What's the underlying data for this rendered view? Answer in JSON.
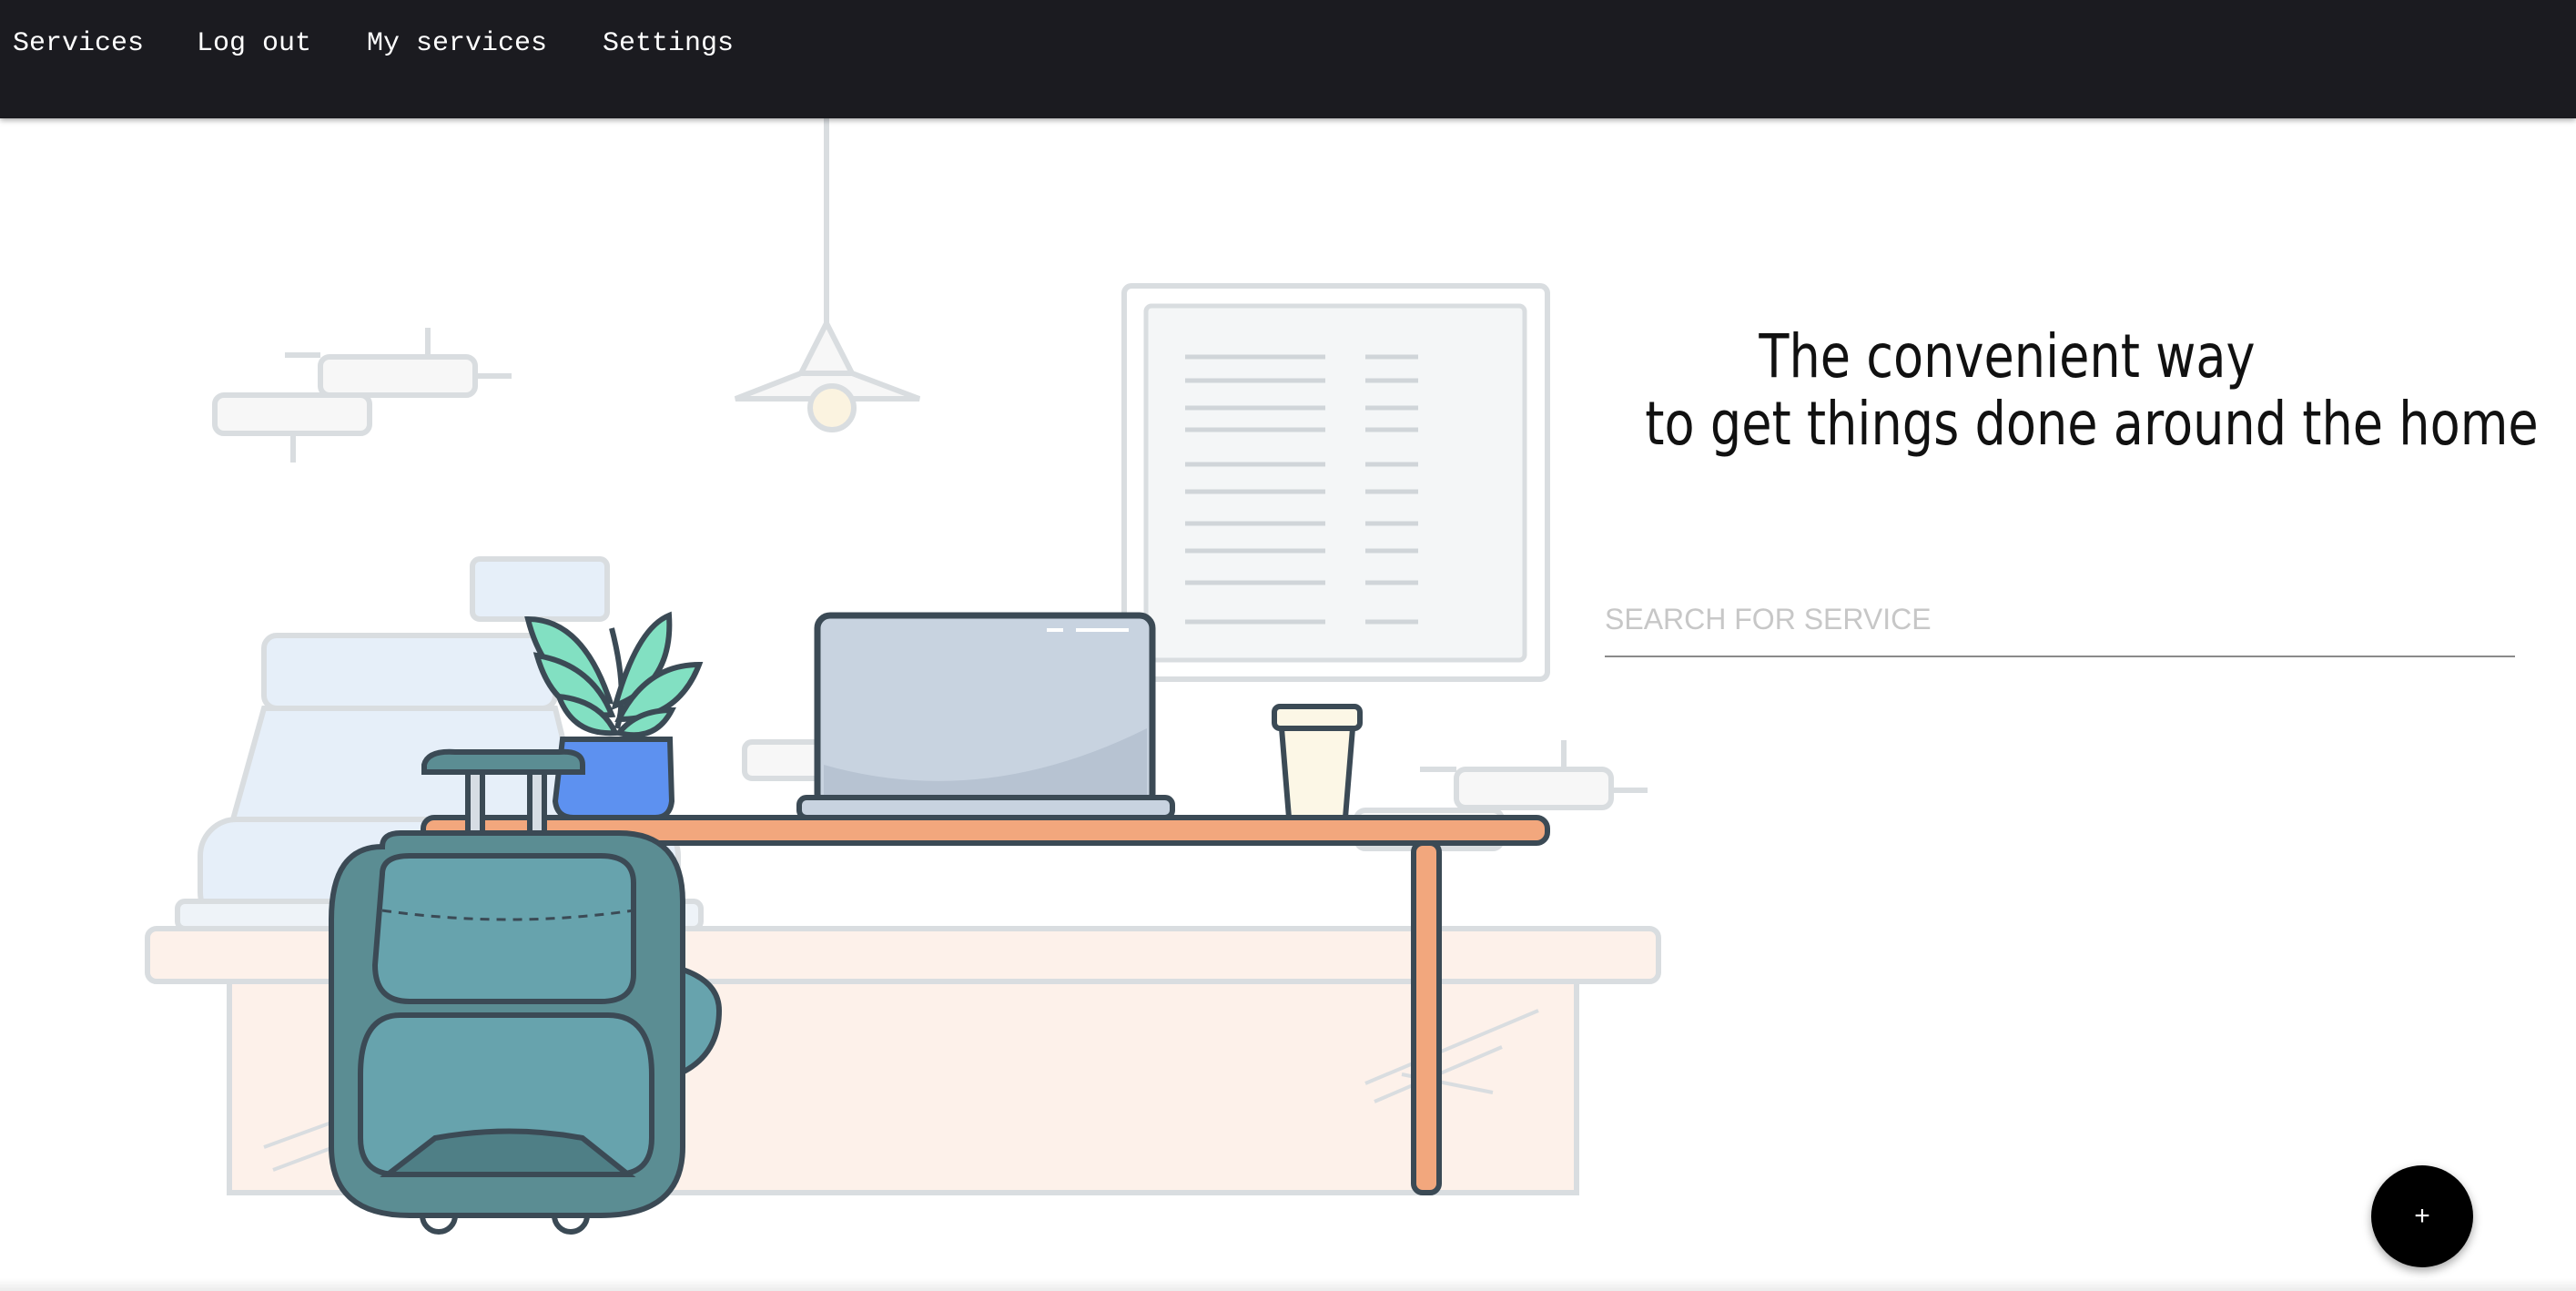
{
  "nav": {
    "items": [
      {
        "label": "Services"
      },
      {
        "label": "Log out"
      },
      {
        "label": "My services"
      },
      {
        "label": "Settings"
      }
    ]
  },
  "hero": {
    "headline_line1": "The convenient way",
    "headline_line2": "to get things done around the home"
  },
  "search": {
    "placeholder": "SEARCH FOR SERVICE",
    "value": ""
  },
  "fab": {
    "label": "+",
    "icon": "plus-icon"
  },
  "colors": {
    "navbar": "#1b1b20",
    "desk_accent": "#f2a77d",
    "suitcase": "#5b8d93",
    "fab": "#000000"
  }
}
